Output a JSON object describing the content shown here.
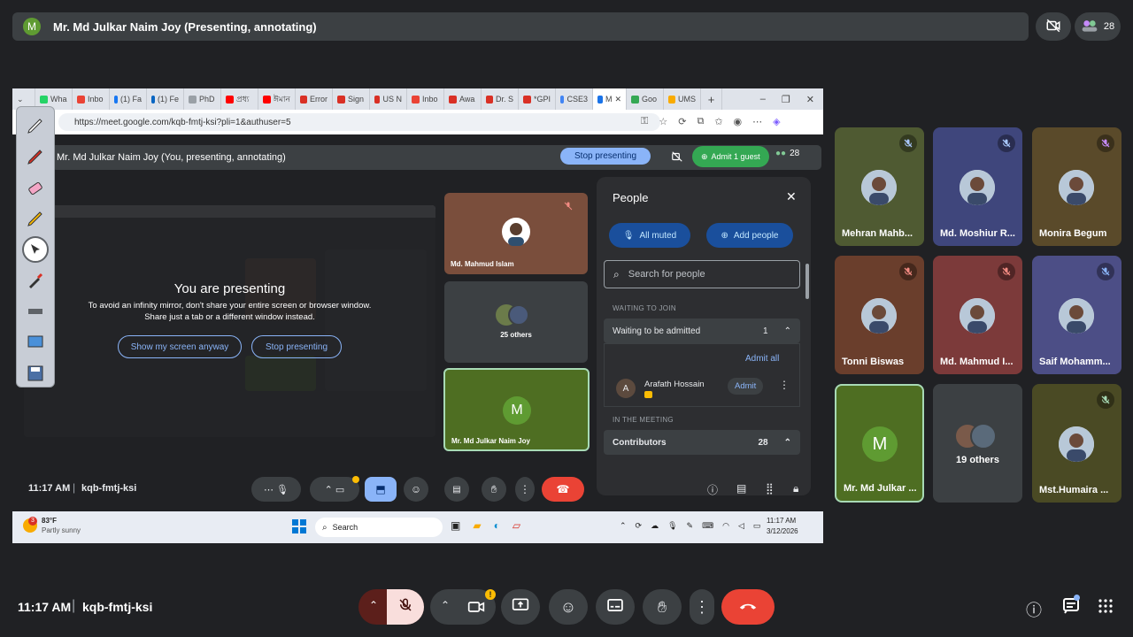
{
  "top": {
    "avatar_letter": "M",
    "title": "Mr. Md Julkar Naim Joy (Presenting, annotating)",
    "participants_count": "28"
  },
  "browser": {
    "tabs": [
      {
        "label": "Wha",
        "color": "#25d366"
      },
      {
        "label": "Inbo",
        "color": "#ea4335"
      },
      {
        "label": "(1) Fa",
        "color": "#1877f2"
      },
      {
        "label": "(1) Fe",
        "color": "#0a66c2"
      },
      {
        "label": "PhD",
        "color": "#9aa0a6"
      },
      {
        "label": "প্রধ্য",
        "color": "#ff0000"
      },
      {
        "label": "ঈমান",
        "color": "#ff0000"
      },
      {
        "label": "Error",
        "color": "#d93025"
      },
      {
        "label": "Sign",
        "color": "#d93025"
      },
      {
        "label": "US N",
        "color": "#d93025"
      },
      {
        "label": "Inbo",
        "color": "#ea4335"
      },
      {
        "label": "Awa",
        "color": "#d93025"
      },
      {
        "label": "Dr. S",
        "color": "#d93025"
      },
      {
        "label": "*GPI",
        "color": "#d93025"
      },
      {
        "label": "CSE3",
        "color": "#4285f4"
      },
      {
        "label": "M",
        "color": "#1a73e8"
      },
      {
        "label": "Goo",
        "color": "#34a853"
      },
      {
        "label": "UMS",
        "color": "#f9ab00"
      }
    ],
    "url": "https://meet.google.com/kqb-fmtj-ksi?pli=1&authuser=5"
  },
  "inner_meet": {
    "title": "Mr. Md Julkar Naim Joy (You, presenting, annotating)",
    "stop_presenting": "Stop presenting",
    "admit_guest": "Admit 1 guest",
    "count": "28",
    "presenting_heading": "You are presenting",
    "presenting_desc1": "To avoid an infinity mirror, don't share your entire screen or browser window.",
    "presenting_desc2": "Share just a tab or a different window instead.",
    "show_anyway": "Show my screen anyway",
    "stop_presenting_btn": "Stop presenting",
    "tiles": {
      "t1_name": "Md. Mahmud Islam",
      "t2_name": "25 others",
      "t3_letter": "M",
      "t3_name": "Mr. Md Julkar Naim Joy"
    },
    "people": {
      "title": "People",
      "all_muted": "All muted",
      "add_people": "Add people",
      "search_placeholder": "Search for people",
      "waiting_section": "WAITING TO JOIN",
      "waiting_label": "Waiting to be admitted",
      "waiting_count": "1",
      "admit_all": "Admit all",
      "guest_letter": "A",
      "guest_name": "Arafath Hossain",
      "admit": "Admit",
      "in_meeting": "IN THE MEETING",
      "contributors": "Contributors",
      "contributors_count": "28"
    },
    "time": "11:17 AM",
    "code": "kqb-fmtj-ksi"
  },
  "taskbar": {
    "temp": "83°F",
    "weather": "Partly sunny",
    "weather_badge": "3",
    "search": "Search",
    "time": "11:17 AM",
    "date": "3/12/2026"
  },
  "grid": [
    {
      "name": "Mehran Mahb...",
      "bg": "#4f5a32"
    },
    {
      "name": "Md. Moshiur R...",
      "bg": "#3f467c"
    },
    {
      "name": "Monira Begum",
      "bg": "#5a4a2a"
    },
    {
      "name": "Tonni Biswas",
      "bg": "#6a3e2c"
    },
    {
      "name": "Md. Mahmud I...",
      "bg": "#7c3a3a"
    },
    {
      "name": "Saif Mohamm...",
      "bg": "#4c4e86"
    },
    {
      "name": "Mr. Md Julkar ...",
      "letter": "M",
      "bg": "#4e6e22"
    },
    {
      "name": "19 others",
      "bg": "#3c4043"
    },
    {
      "name": "Mst.Humaira ...",
      "bg": "#4a4a24"
    }
  ],
  "bottom": {
    "time": "11:17 AM",
    "code": "kqb-fmtj-ksi"
  }
}
